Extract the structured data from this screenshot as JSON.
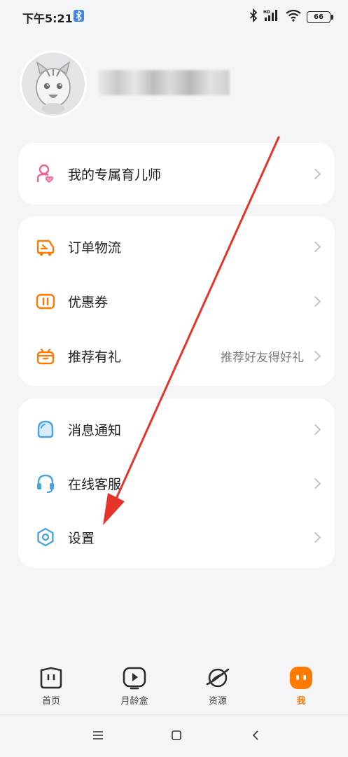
{
  "status_bar": {
    "time": "下午5:21",
    "battery": "66"
  },
  "menu_groups": [
    {
      "items": [
        {
          "label": "我的专属育儿师",
          "icon": "nanny-icon"
        }
      ]
    },
    {
      "items": [
        {
          "label": "订单物流",
          "icon": "delivery-truck-icon"
        },
        {
          "label": "优惠券",
          "icon": "coupon-icon"
        },
        {
          "label": "推荐有礼",
          "icon": "gift-icon",
          "value": "推荐好友得好礼"
        }
      ]
    },
    {
      "items": [
        {
          "label": "消息通知",
          "icon": "message-bubble-icon"
        },
        {
          "label": "在线客服",
          "icon": "headset-icon"
        },
        {
          "label": "设置",
          "icon": "settings-hexagon-icon"
        }
      ]
    }
  ],
  "tabbar": {
    "tabs": [
      {
        "label": "首页",
        "icon": "home-book-icon"
      },
      {
        "label": "月龄盒",
        "icon": "play-box-icon"
      },
      {
        "label": "资源",
        "icon": "planet-icon"
      },
      {
        "label": "我",
        "icon": "me-face-icon",
        "active": true
      }
    ]
  },
  "colors": {
    "accent_orange": "#ff7a00",
    "pink": "#f0619a",
    "blue": "#4aa3e0",
    "arrow_red": "#e8332a"
  }
}
